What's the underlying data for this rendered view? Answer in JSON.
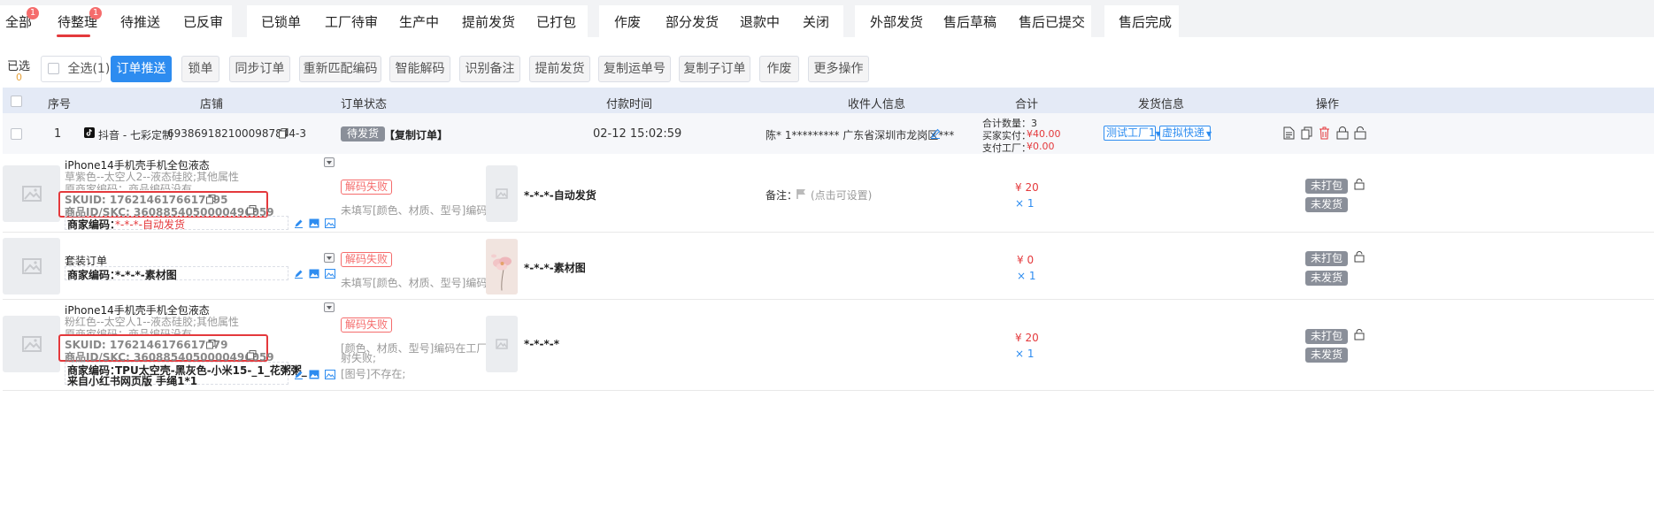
{
  "tabs": {
    "group1": [
      {
        "label": "全部",
        "badge": "1"
      },
      {
        "label": "待整理",
        "badge": "1",
        "active": true
      },
      {
        "label": "待推送"
      },
      {
        "label": "已反审"
      }
    ],
    "group2": [
      {
        "label": "已锁单"
      },
      {
        "label": "工厂待审"
      },
      {
        "label": "生产中"
      },
      {
        "label": "提前发货"
      },
      {
        "label": "已打包"
      }
    ],
    "group3": [
      {
        "label": "作废"
      },
      {
        "label": "部分发货"
      },
      {
        "label": "退款中"
      },
      {
        "label": "关闭"
      }
    ],
    "group4": [
      {
        "label": "外部发货"
      },
      {
        "label": "售后草稿"
      },
      {
        "label": "售后已提交"
      }
    ],
    "group5": [
      {
        "label": "售后完成"
      }
    ]
  },
  "toolbar": {
    "selected_label": "已选",
    "selected_count": "0",
    "select_all": "全选(1)",
    "buttons": [
      "订单推送",
      "锁单",
      "同步订单",
      "重新匹配编码",
      "智能解码",
      "识别备注",
      "提前发货",
      "复制运单号",
      "复制子订单",
      "作废",
      "更多操作"
    ]
  },
  "table_header": {
    "seq": "序号",
    "shop": "店铺",
    "status": "订单状态",
    "pay_time": "付款时间",
    "receiver": "收件人信息",
    "total": "合计",
    "ship_info": "发货信息",
    "ops": "操作"
  },
  "order": {
    "seq": "1",
    "shop": "抖音 - 七彩定制",
    "order_no": "6938691821000987844-3",
    "status_tag": "待发货",
    "copy_order": "【复制订单】",
    "pay_time": "02-12 15:02:59",
    "receiver": "陈*  1*********  广东省深圳市龙岗区***",
    "total_qty": "合计数量：3",
    "buyer_paid_label": "买家实付：",
    "buyer_paid": "¥40.00",
    "factory_paid_label": "支付工厂：",
    "factory_paid": "¥0.00",
    "factory_select": "测试工厂1",
    "express_select": "虚拟快递"
  },
  "items": [
    {
      "title": "iPhone14手机壳手机全包液态",
      "spec": "草紫色--太空人2--液态硅胶;其他属性",
      "orig_code": "原商家编码：商品编码没有",
      "skuid": "SKUID:  1762146176617495",
      "skc": "商品ID/SKC:  3608854050000496059",
      "merchant_code_label": "商家编码：",
      "merchant_code": "*-*-*-自动发货",
      "fail": "解码失败",
      "fail_note": "未填写[颜色、材质、型号]编码;",
      "product_name": "*-*-*-自动发货",
      "remark_label": "备注：",
      "remark_hint": "(点击可设置)",
      "price": "¥ 20",
      "qty": "× 1",
      "pack": "未打包",
      "ship": "未发货"
    },
    {
      "title": "套装订单",
      "merchant_code_label": "商家编码：",
      "merchant_code": "*-*-*-素材图",
      "fail": "解码失败",
      "fail_note": "未填写[颜色、材质、型号]编码;",
      "product_name": "*-*-*-素材图",
      "price": "¥ 0",
      "qty": "× 1",
      "pack": "未打包",
      "ship": "未发货"
    },
    {
      "title": "iPhone14手机壳手机全包液态",
      "spec": "粉红色--太空人1--液态硅胶;其他属性",
      "orig_code": "原商家编码：商品编码没有",
      "skuid": "SKUID:  1762146176617479",
      "skc": "商品ID/SKC:  3608854050000496059",
      "merchant_code_label": "商家编码：",
      "merchant_code_line1": "TPU太空壳-黑灰色-小米15-_1_花粥粥_",
      "merchant_code_line2": "来自小红书网页版  手绳1*1",
      "fail": "解码失败",
      "fail_note1": "[颜色、材质、型号]编码在工厂映",
      "fail_note2": "射失败;",
      "fail_note3": "[图号]不存在;",
      "product_name": "*-*-*-*",
      "price": "¥ 20",
      "qty": "× 1",
      "pack": "未打包",
      "ship": "未发货"
    }
  ]
}
